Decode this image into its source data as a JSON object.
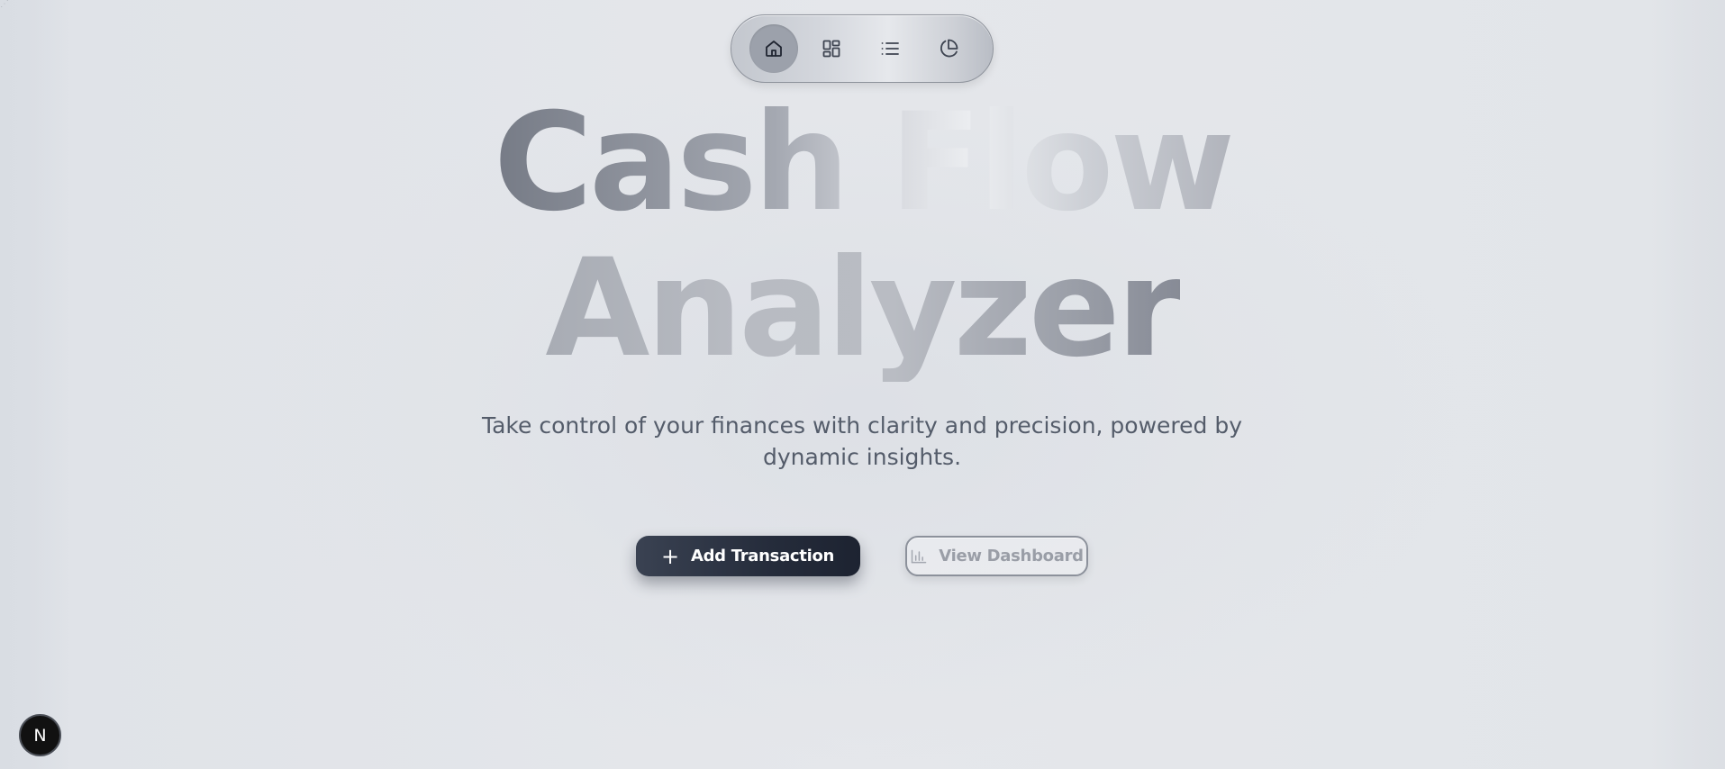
{
  "nav": {
    "items": [
      {
        "name": "home",
        "icon": "home-icon",
        "active": true
      },
      {
        "name": "dashboard",
        "icon": "grid-icon",
        "active": false
      },
      {
        "name": "transactions",
        "icon": "list-icon",
        "active": false
      },
      {
        "name": "reports",
        "icon": "pie-chart-icon",
        "active": false
      }
    ]
  },
  "hero": {
    "title_line1": "Cash Flow",
    "title_line2": "Analyzer",
    "subtitle": "Take control of your finances with clarity and precision, powered by dynamic insights."
  },
  "actions": {
    "primary_icon": "plus-icon",
    "primary_label": "Add Transaction",
    "secondary_icon": "bar-chart-icon",
    "secondary_label": "View Dashboard"
  },
  "badge": {
    "letter": "N"
  },
  "colors": {
    "primary_button": "#252c3b",
    "background": "#e5e7eb",
    "subtitle_text": "#545c6a",
    "active_nav": "#9ca1ab"
  }
}
